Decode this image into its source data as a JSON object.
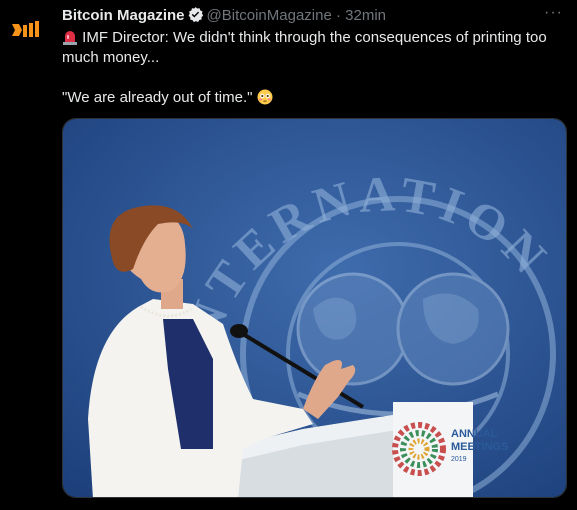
{
  "author": {
    "name": "Bitcoin Magazine",
    "handle": "@BitcoinMagazine",
    "separator": "·",
    "time": "32min",
    "more": "···"
  },
  "tweet": {
    "line1": "IMF Director: We didn't think through the consequences of printing too",
    "line2": "much money...",
    "line3": "\"We are already out of time.\"",
    "siren_icon": "police-light-emoji",
    "flushed_icon": "flushed-face-emoji"
  },
  "photo": {
    "logo_text": "INTERNATIONAL",
    "banner_line1": "ANNUAL",
    "banner_line2": "MEETINGS",
    "banner_year": "2019"
  },
  "colors": {
    "background": "#000000",
    "text": "#e7e9ea",
    "muted": "#71767b",
    "verified": "#1d9bf0",
    "brand": "#f7931a"
  }
}
